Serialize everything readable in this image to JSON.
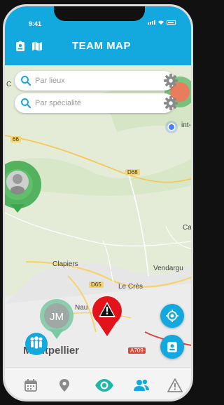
{
  "status": {
    "time": "9:41"
  },
  "header": {
    "title": "TEAM MAP",
    "left_icons": [
      "badge-icon",
      "map-icon"
    ]
  },
  "search": {
    "places_placeholder": "Par lieux",
    "speciality_placeholder": "Par spécialité"
  },
  "map": {
    "labels": {
      "clapiers": "Clapiers",
      "le_cres": "Le Crès",
      "vendargues": "Vendargu",
      "montpellier": "Montpellier",
      "nau": "Nau",
      "saint": "int-",
      "ca": "Ca",
      "c": "C"
    },
    "roads": {
      "d68": "D68",
      "d65": "D65",
      "d66": "66",
      "a709": "A709"
    },
    "markers": {
      "user_initials": "JM"
    }
  },
  "colors": {
    "primary": "#13a9df",
    "alert": "#e3131b",
    "green_ring": "#3aa84a",
    "teal_marker": "#7bc8a4",
    "nav_active": "#1fb8a8"
  },
  "nav": {
    "items": [
      "calendar-icon",
      "location-pin-icon",
      "eye-icon",
      "team-icon",
      "warning-icon"
    ],
    "active": "eye-icon"
  }
}
